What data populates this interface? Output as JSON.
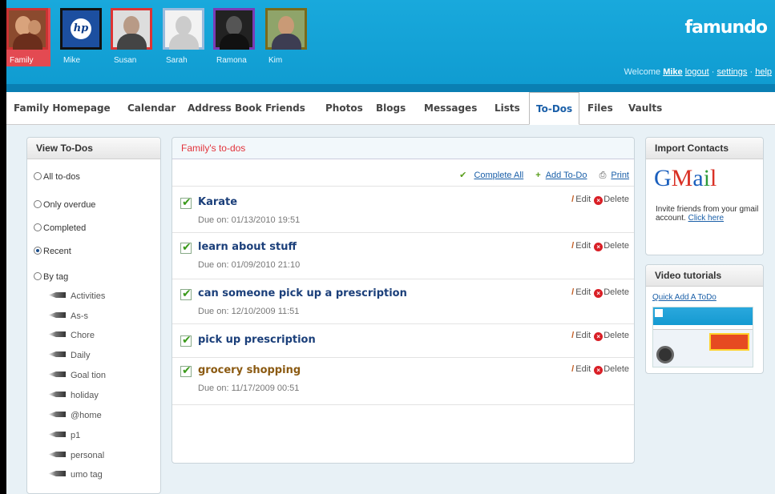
{
  "header": {
    "brand": "famundo",
    "members": [
      {
        "name": "Family",
        "active": true
      },
      {
        "name": "Mike",
        "active": false
      },
      {
        "name": "Susan",
        "active": false
      },
      {
        "name": "Sarah",
        "active": false
      },
      {
        "name": "Ramona",
        "active": false
      },
      {
        "name": "Kim",
        "active": false
      }
    ],
    "welcome": "Welcome",
    "user": "Mike",
    "logout": "logout",
    "settings": "settings",
    "help": "help"
  },
  "nav": [
    "Family Homepage",
    "Calendar",
    "Address Book",
    "Friends",
    "Photos",
    "Blogs",
    "Messages",
    "Lists",
    "To-Dos",
    "Files",
    "Vaults"
  ],
  "left": {
    "title": "View To-Dos",
    "filters": [
      {
        "label": "All to-dos",
        "checked": false
      },
      {
        "label": "Only overdue",
        "checked": false
      },
      {
        "label": "Completed",
        "checked": false
      },
      {
        "label": "Recent",
        "checked": true
      },
      {
        "label": "By tag",
        "checked": false
      }
    ],
    "tags": [
      "Activities",
      "As-s",
      "Chore",
      "Daily",
      "Goal tion",
      "holiday",
      "@home",
      "p1",
      "personal",
      "umo tag"
    ]
  },
  "main": {
    "title": "Family's to-dos",
    "actions": {
      "complete": "Complete All",
      "add": "Add To-Do",
      "print": "Print"
    },
    "edit": "Edit",
    "delete": "Delete",
    "todos": [
      {
        "title": "Karate",
        "due": "Due on: 01/13/2010 19:51"
      },
      {
        "title": "learn about stuff",
        "due": "Due on: 01/09/2010 21:10"
      },
      {
        "title": "can someone pick up a prescription",
        "due": "Due on: 12/10/2009 11:51"
      },
      {
        "title": "pick up prescription",
        "due": ""
      },
      {
        "title": "grocery shopping",
        "due": "Due on: 11/17/2009 00:51"
      }
    ]
  },
  "import": {
    "title": "Import Contacts",
    "logo": "Gmail",
    "text": "Invite friends from your gmail account.",
    "link": "Click here"
  },
  "video": {
    "title": "Video tutorials",
    "link": "Quick Add A ToDo"
  },
  "colors": {
    "header": "#19a9dc",
    "accent": "#e2333b",
    "link": "#1a5fa8",
    "check": "#3a9a1a"
  }
}
